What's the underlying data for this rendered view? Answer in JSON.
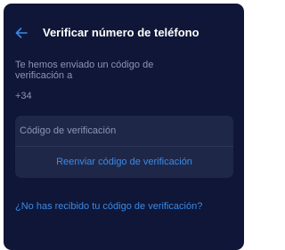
{
  "header": {
    "title": "Verificar número de teléfono",
    "back_icon": "arrow-left-icon"
  },
  "message": {
    "text": "Te hemos enviado un código de verificación a",
    "phone": "+34"
  },
  "form": {
    "code_placeholder": "Código de verificación",
    "resend_label": "Reenviar código de verificación"
  },
  "help_link": "¿No has recibido tu código de verificación?",
  "colors": {
    "background": "#0f1637",
    "card": "#1f2748",
    "accent": "#3a8ae8",
    "muted_text": "#8e94b5"
  }
}
